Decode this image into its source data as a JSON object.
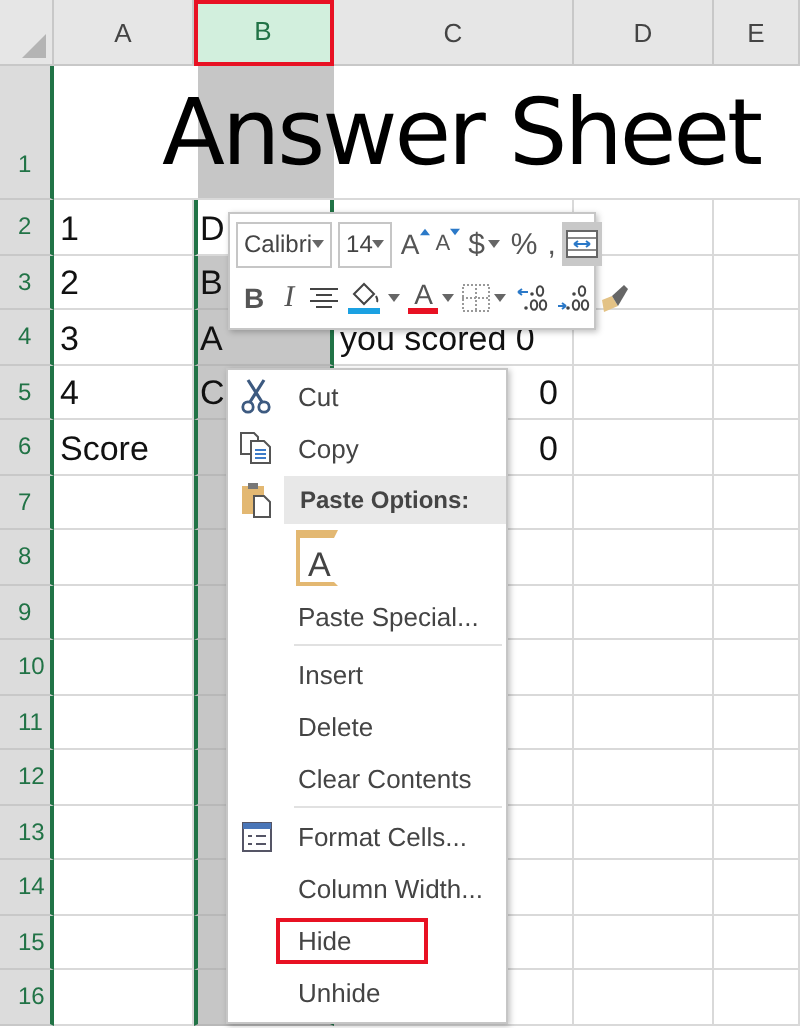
{
  "sheet": {
    "columns": [
      {
        "label": "A",
        "selected": false,
        "highlighted": false
      },
      {
        "label": "B",
        "selected": true,
        "highlighted": true
      },
      {
        "label": "C",
        "selected": false,
        "highlighted": false
      },
      {
        "label": "D",
        "selected": false,
        "highlighted": false
      },
      {
        "label": "E",
        "selected": false,
        "highlighted": false
      }
    ],
    "title_row": {
      "header": "1",
      "title": "Answer Sheet"
    },
    "rows": [
      {
        "header": "2",
        "active": true,
        "cells": [
          {
            "kind": "text",
            "text": "1"
          },
          {
            "kind": "text",
            "text": "D"
          }
        ]
      },
      {
        "header": "3",
        "active": false,
        "cells": [
          {
            "kind": "text",
            "text": "2"
          },
          {
            "kind": "text",
            "text": "B"
          }
        ]
      },
      {
        "header": "4",
        "active": false,
        "cells": [
          {
            "kind": "text",
            "text": "3"
          },
          {
            "kind": "text",
            "text": "A"
          },
          {
            "kind": "text",
            "text": "you scored 0"
          }
        ]
      },
      {
        "header": "5",
        "active": false,
        "cells": [
          {
            "kind": "text",
            "text": "4"
          },
          {
            "kind": "text",
            "text": "C"
          },
          {
            "kind": "number",
            "text": "0"
          }
        ]
      },
      {
        "header": "6",
        "active": false,
        "cells": [
          {
            "kind": "text",
            "text": "Score"
          },
          {
            "kind": "empty"
          },
          {
            "kind": "number",
            "text": "0"
          }
        ]
      },
      {
        "header": "7",
        "active": false,
        "cells": []
      },
      {
        "header": "8",
        "active": false,
        "cells": []
      },
      {
        "header": "9",
        "active": false,
        "cells": []
      },
      {
        "header": "10",
        "active": false,
        "cells": []
      },
      {
        "header": "11",
        "active": false,
        "cells": []
      },
      {
        "header": "12",
        "active": false,
        "cells": []
      },
      {
        "header": "13",
        "active": false,
        "cells": []
      },
      {
        "header": "14",
        "active": false,
        "cells": []
      },
      {
        "header": "15",
        "active": false,
        "cells": []
      },
      {
        "header": "16",
        "active": false,
        "cells": []
      }
    ]
  },
  "mini_toolbar": {
    "font": "Calibri",
    "size": "14",
    "row1": [
      {
        "kind": "grow",
        "label": "A",
        "selected": false
      },
      {
        "kind": "shrink",
        "label": "A",
        "selected": false
      },
      {
        "kind": "text",
        "label": "$",
        "dropdown": true,
        "selected": false
      },
      {
        "kind": "text",
        "label": "%",
        "dropdown": false,
        "selected": false
      },
      {
        "kind": "text",
        "label": ",",
        "dropdown": false,
        "selected": false
      },
      {
        "kind": "wrap",
        "selected": true
      }
    ],
    "row2": [
      {
        "kind": "bold",
        "label": "B",
        "selected": false
      },
      {
        "kind": "italic",
        "label": "I",
        "selected": false
      },
      {
        "kind": "align",
        "selected": false
      },
      {
        "kind": "fill",
        "color": "#1ba1e2",
        "dropdown": true,
        "selected": false
      },
      {
        "kind": "font-color",
        "label": "A",
        "color": "#e81123",
        "dropdown": true,
        "selected": false
      },
      {
        "kind": "borders",
        "dropdown": true,
        "selected": false
      },
      {
        "kind": "inc-decimal",
        "selected": false
      },
      {
        "kind": "dec-decimal",
        "selected": false
      },
      {
        "kind": "painter",
        "selected": false
      }
    ]
  },
  "context_menu": [
    {
      "kind": "cut",
      "label": "Cut",
      "highlighted": false
    },
    {
      "kind": "copy",
      "label": "Copy",
      "highlighted": false
    },
    {
      "kind": "header",
      "label": "Paste Options:"
    },
    {
      "kind": "paste-option",
      "label": "A"
    },
    {
      "kind": "item",
      "label": "Paste Special...",
      "highlighted": false
    },
    {
      "kind": "separator"
    },
    {
      "kind": "item",
      "label": "Insert",
      "highlighted": false
    },
    {
      "kind": "item",
      "label": "Delete",
      "highlighted": false
    },
    {
      "kind": "item",
      "label": "Clear Contents",
      "highlighted": false
    },
    {
      "kind": "separator"
    },
    {
      "kind": "format",
      "label": "Format Cells...",
      "highlighted": false
    },
    {
      "kind": "item",
      "label": "Column Width...",
      "highlighted": false
    },
    {
      "kind": "item",
      "label": "Hide",
      "highlighted": true
    },
    {
      "kind": "item",
      "label": "Unhide",
      "highlighted": false
    }
  ]
}
